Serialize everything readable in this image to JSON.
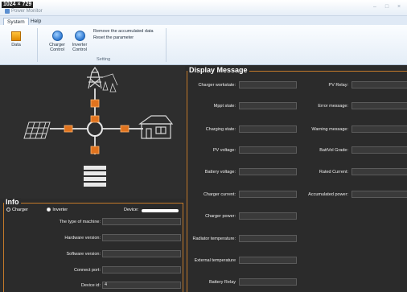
{
  "window": {
    "badge": "1024 × 729",
    "title": "Power Monitor",
    "buttons": [
      "–",
      "□",
      "×"
    ]
  },
  "ribbon": {
    "tabs": [
      "System",
      "Help"
    ],
    "active_tab": "System",
    "data_label": "Data",
    "charger_control_label": "Charger\nControl",
    "inverter_control_label": "Inverter\nControl",
    "remove_accumulated": "Remove the accumulated data",
    "reset_parameter": "Reset the parameter",
    "group_label": "Setting"
  },
  "info": {
    "title": "Info",
    "charger_radio": "Charger",
    "inverter_radio": "Inverter",
    "selected_radio": "Inverter",
    "device_label": "Device:",
    "fields": [
      {
        "label": "The type of machine:",
        "value": ""
      },
      {
        "label": "Hardware version:",
        "value": ""
      },
      {
        "label": "Software version:",
        "value": ""
      },
      {
        "label": "Connect port:",
        "value": ""
      },
      {
        "label": "Device id:",
        "value": "4"
      }
    ]
  },
  "display": {
    "title": "Display Message",
    "left_fields": [
      {
        "label": "Charger workstate:",
        "value": ""
      },
      {
        "label": "Mppt state:",
        "value": ""
      },
      {
        "label": "Charging state:",
        "value": ""
      },
      {
        "label": "PV voltage:",
        "value": ""
      },
      {
        "label": "Battery voltage:",
        "value": ""
      },
      {
        "label": "Charger current:",
        "value": ""
      },
      {
        "label": "Charger power:",
        "value": ""
      },
      {
        "label": "Radiator temperature:",
        "value": ""
      },
      {
        "label": "External temperature",
        "value": ""
      },
      {
        "label": "Battery Relay",
        "value": ""
      }
    ],
    "right_fields": [
      {
        "label": "PV Relay:",
        "value": ""
      },
      {
        "label": "Error message:",
        "value": ""
      },
      {
        "label": "Warning message:",
        "value": ""
      },
      {
        "label": "BattVol Grade:",
        "value": ""
      },
      {
        "label": "Rated Current:",
        "value": ""
      },
      {
        "label": "Accumulated power:",
        "value": ""
      }
    ]
  },
  "colors": {
    "panel_border": "#c47a2a",
    "background": "#2b2b2b",
    "node_orange": "#e0731e"
  }
}
